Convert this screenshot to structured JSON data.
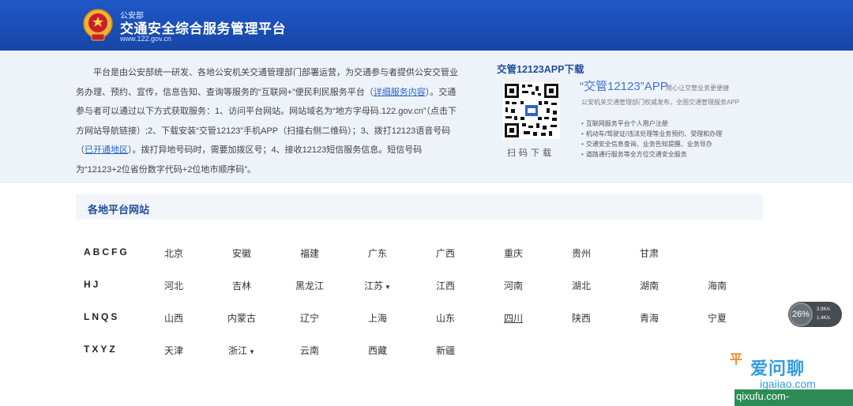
{
  "header": {
    "ministry": "公安部",
    "title": "交通安全综合服务管理平台",
    "url": "www.122.gov.cn"
  },
  "intro": {
    "p1": "平台是由公安部统一研发、各地公安机关交通管理部门部署运营，为交通参与者提供公安交管业务办理、预约、宣传，信息告知、查询等服务的“互联网+”便民利民服务平台（",
    "link1": "详细服务内容",
    "p2": "）。交通参与者可以通过以下方式获取服务：1、访问平台网站。网站域名为“地方字母码.122.gov.cn”（点击下方网站导航链接）;2、下载安装“交管12123”手机APP（扫描右侧二维码）；3、拨打12123语音号码（",
    "link2": "已开通地区",
    "p3": "）。拨打异地号码时，需要加拨区号；4、接收12123短信服务信息。短信号码为“12123+2位省份数字代码+2位地市顺序码”。"
  },
  "app": {
    "download_title": "交管12123APP下载",
    "scan_label": "扫码下载",
    "name": "“交管12123”APP",
    "subtitle": "用心让交管业务更便捷",
    "authority": "公安机关交通管理部门权威发布，全国交通管理服务APP",
    "features": [
      "互联网服务平台个人用户注册",
      "机动车/驾驶证/违法处理等业务预约、受理和办理",
      "交通安全信息查询、业务告知提醒、业务导办",
      "道路通行服务等全方位交通安全服务"
    ]
  },
  "regions": {
    "title": "各地平台网站",
    "rows": [
      {
        "letters": "ABCFG",
        "provinces": [
          "北京",
          "安徽",
          "福建",
          "广东",
          "广西",
          "重庆",
          "贵州",
          "甘肃"
        ]
      },
      {
        "letters": "HJ",
        "provinces": [
          "河北",
          "吉林",
          "黑龙江",
          "江苏",
          "江西",
          "河南",
          "湖北",
          "湖南",
          "海南"
        ]
      },
      {
        "letters": "LNQS",
        "provinces": [
          "山西",
          "内蒙古",
          "辽宁",
          "上海",
          "山东",
          "四川",
          "陕西",
          "青海",
          "宁夏"
        ]
      },
      {
        "letters": "TXYZ",
        "provinces": [
          "天津",
          "浙江",
          "云南",
          "西藏",
          "新疆"
        ]
      }
    ],
    "dropdown_marker": "▼"
  },
  "widget": {
    "percent": "26%",
    "up": "3.9K/s",
    "down": "1.4K/s"
  },
  "watermark": {
    "text": "爱问聊",
    "url": "igaiiao.com",
    "green": "qixufu.com-",
    "partial": "平"
  },
  "colors": {
    "header": "#1e57c6",
    "accent": "#1f4d9a",
    "band": "#eef3fa"
  }
}
